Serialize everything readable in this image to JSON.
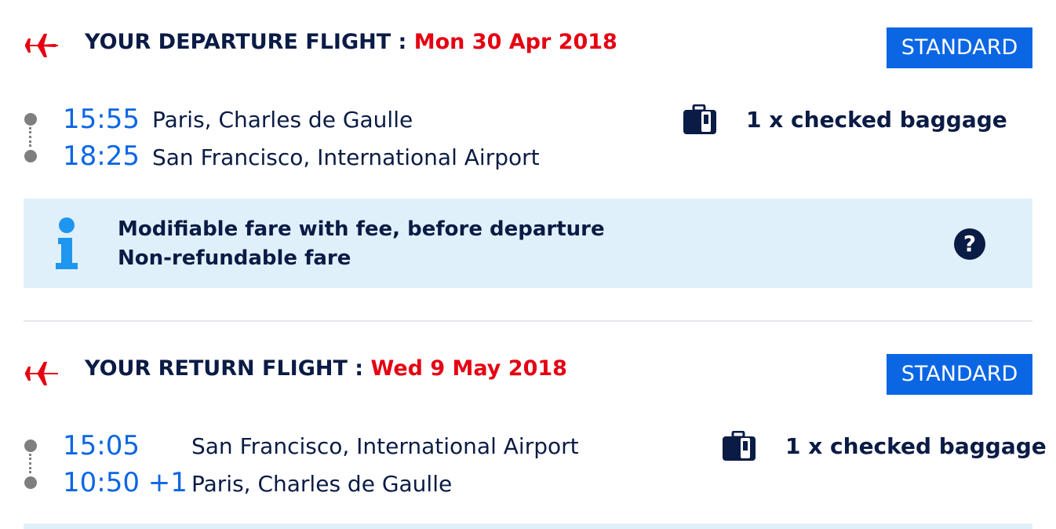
{
  "departure": {
    "heading_label": "YOUR DEPARTURE FLIGHT : ",
    "date": "Mon 30 Apr 2018",
    "fare_class": "STANDARD",
    "dep_time": "15:55",
    "dep_place": "Paris, Charles de Gaulle",
    "arr_time": "18:25",
    "arr_place": "San Francisco, International Airport",
    "baggage": "1 x checked baggage",
    "info": {
      "line1": "Modifiable fare with fee, before departure",
      "line2": "Non-refundable fare",
      "help": "?"
    }
  },
  "return": {
    "heading_label": "YOUR RETURN FLIGHT : ",
    "date": "Wed 9 May 2018",
    "fare_class": "STANDARD",
    "dep_time": "15:05",
    "dep_place": "San Francisco, International Airport",
    "arr_time": "10:50 +1",
    "arr_place": "Paris, Charles de Gaulle",
    "baggage": "1 x checked baggage"
  },
  "colors": {
    "accent_blue": "#0b66e4",
    "date_red": "#e50012",
    "navy": "#0a1b45",
    "info_bg": "#e0f0fb",
    "info_icon": "#1e96f0"
  },
  "icons": [
    "plane-icon",
    "baggage-icon",
    "info-icon",
    "help-icon"
  ]
}
